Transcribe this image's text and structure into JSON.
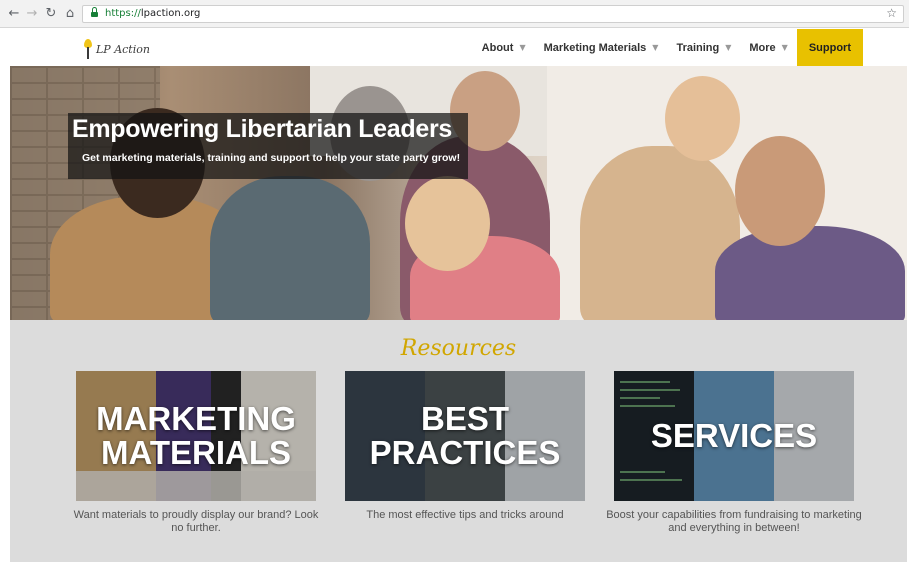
{
  "browser": {
    "url_scheme": "https://",
    "url_host": "lpaction.org",
    "back_icon": "arrow-left-icon",
    "forward_icon": "arrow-right-icon",
    "reload_icon": "reload-icon",
    "home_icon": "home-icon",
    "bookmark_icon": "star-icon"
  },
  "header": {
    "logo_text": "LP Action",
    "menu": [
      {
        "label": "About",
        "has_dropdown": true
      },
      {
        "label": "Marketing Materials",
        "has_dropdown": true
      },
      {
        "label": "Training",
        "has_dropdown": true
      },
      {
        "label": "More",
        "has_dropdown": true
      },
      {
        "label": "Support",
        "has_dropdown": false
      }
    ],
    "support_color": "#e8c100"
  },
  "hero": {
    "title": "Empowering Libertarian Leaders",
    "subtitle": "Get marketing materials, training and support to help your state party grow!"
  },
  "resources": {
    "heading": "Resources",
    "heading_color": "#d1a600",
    "cards": [
      {
        "title_line1": "MARKETING",
        "title_line2": "MATERIALS",
        "description": "Want materials to proudly display our brand? Look no further."
      },
      {
        "title_line1": "BEST",
        "title_line2": "PRACTICES",
        "description": "The most effective tips and tricks around"
      },
      {
        "title_line1": "SERVICES",
        "title_line2": "",
        "description": "Boost your capabilities from fundraising to marketing and everything in between!"
      }
    ]
  }
}
